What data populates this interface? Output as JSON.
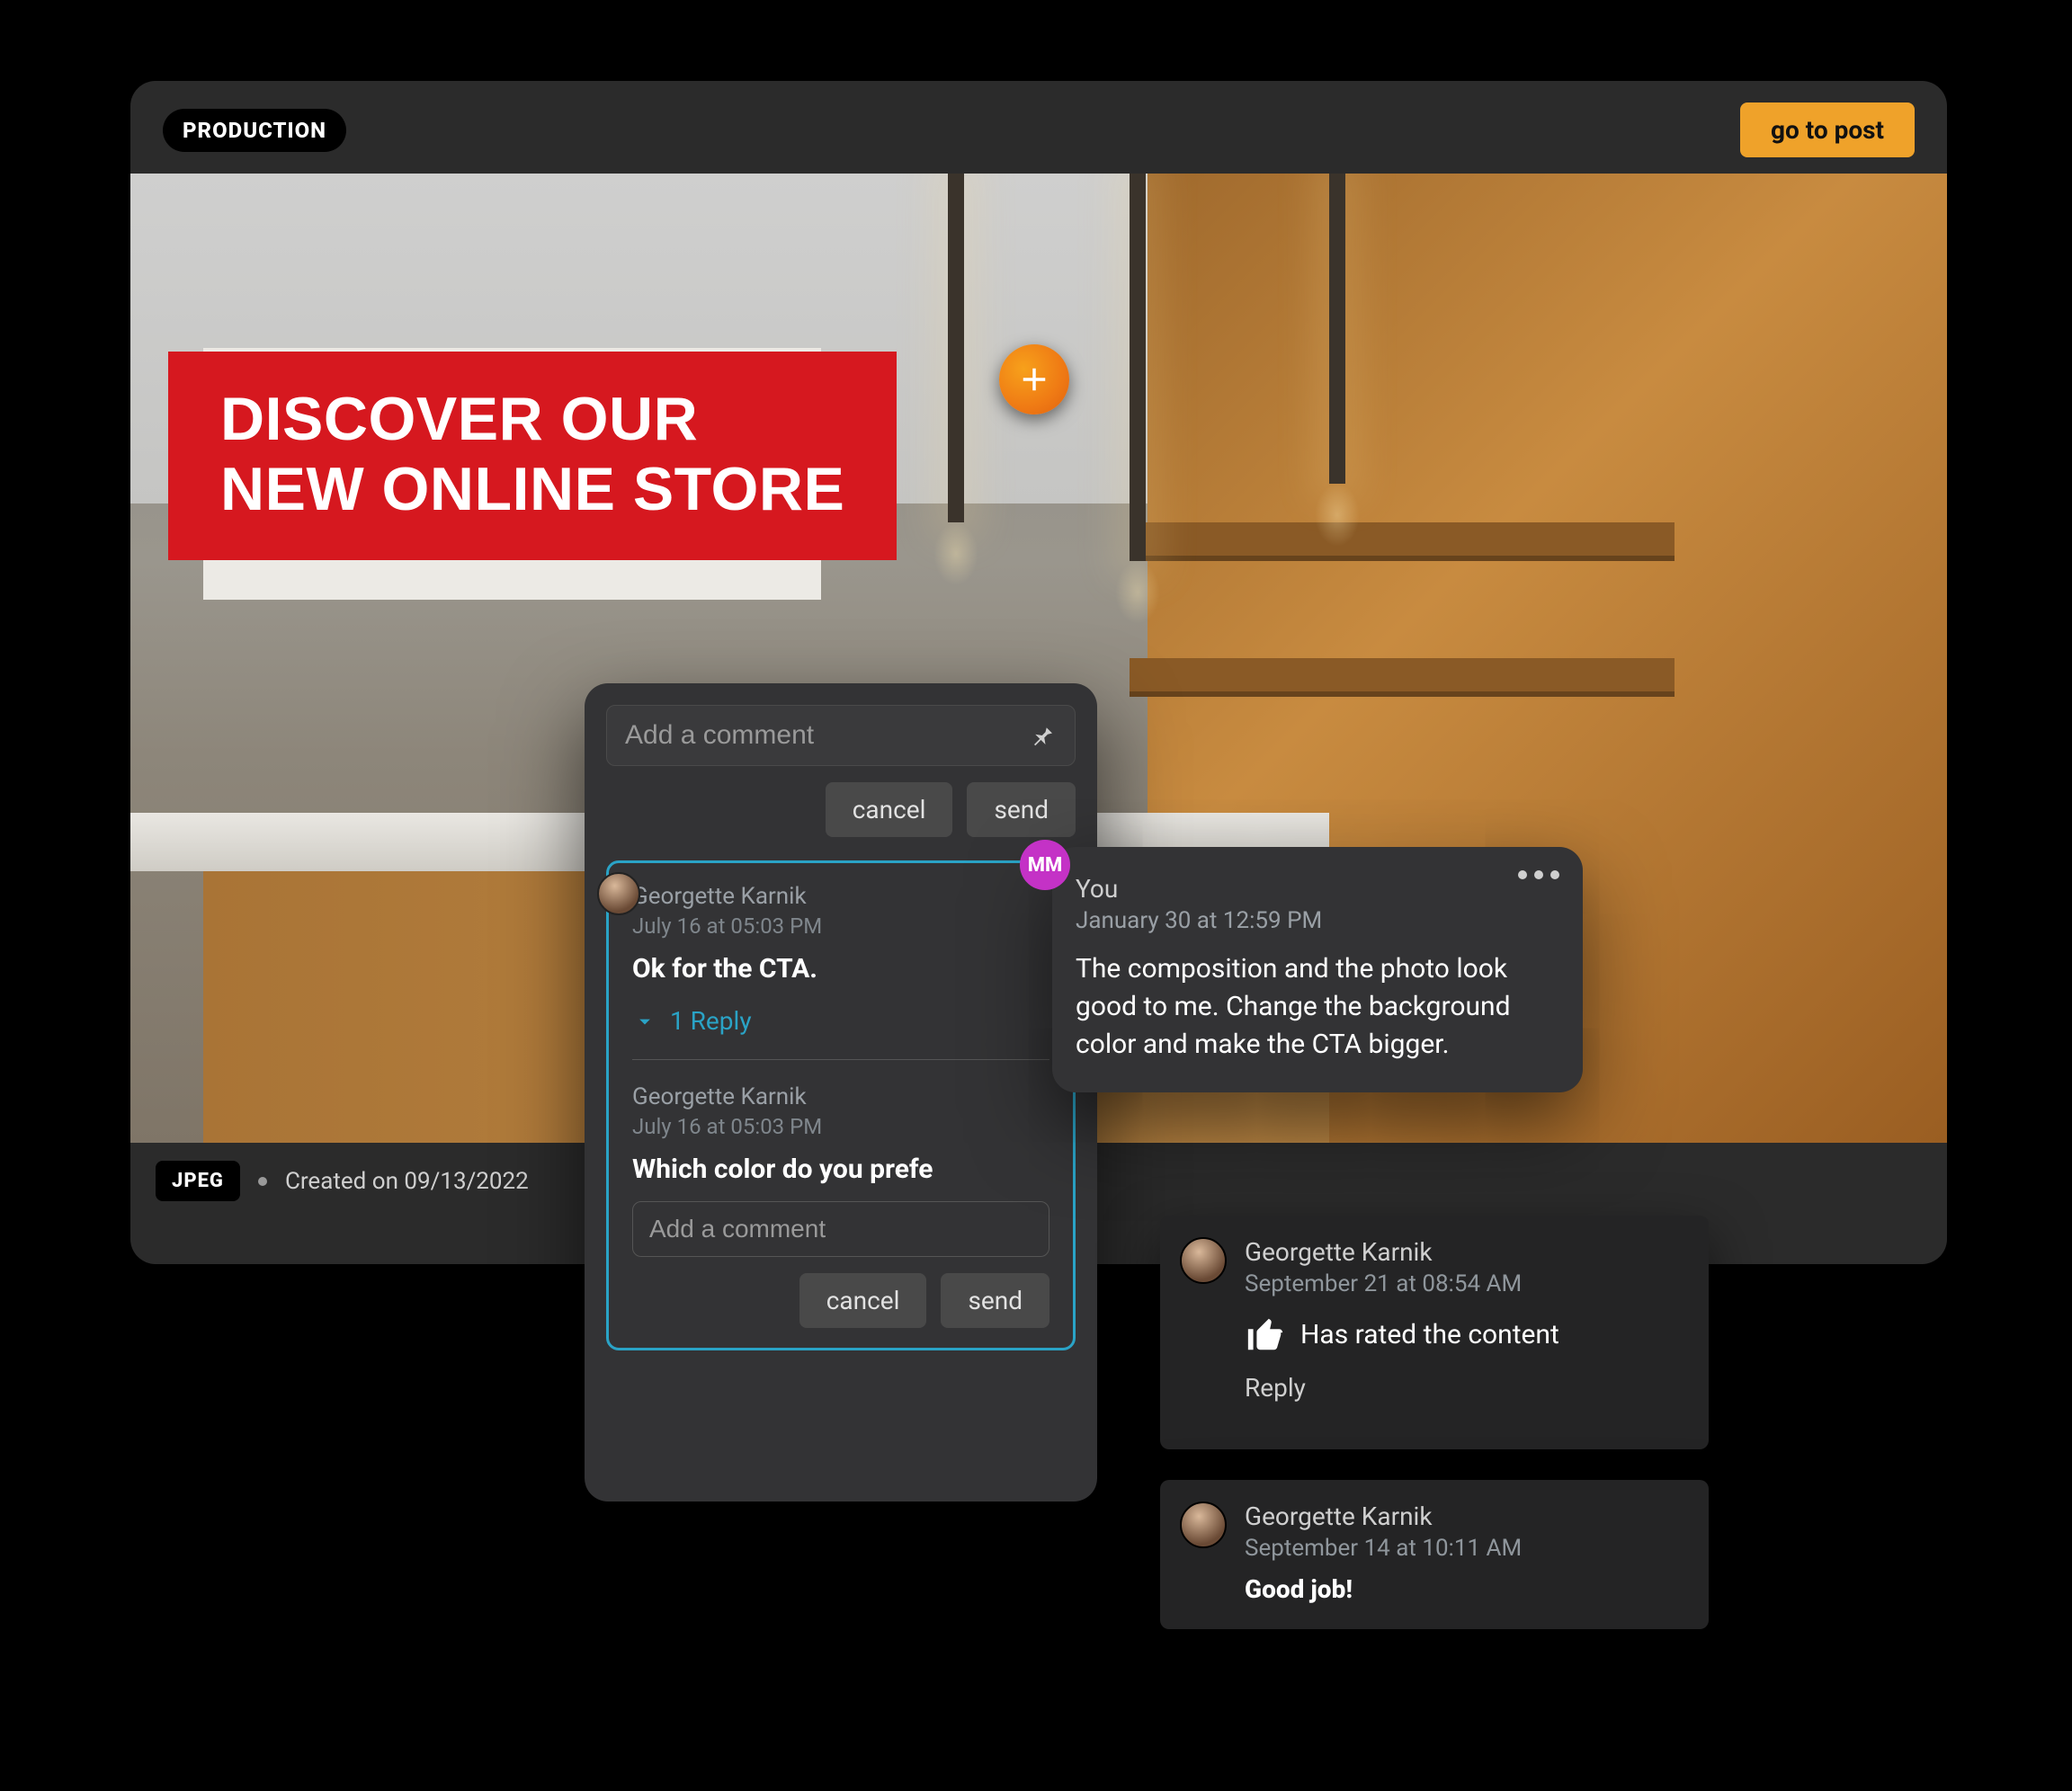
{
  "header": {
    "badge": "PRODUCTION",
    "go_to_post": "go to post"
  },
  "banner": {
    "line1": "DISCOVER OUR",
    "line2": "NEW ONLINE STORE"
  },
  "footer": {
    "format": "JPEG",
    "created": "Created on 09/13/2022"
  },
  "compose": {
    "placeholder": "Add a comment",
    "cancel": "cancel",
    "send": "send"
  },
  "thread": {
    "c1": {
      "author": "Georgette Karnik",
      "date": "July 16 at 05:03 PM",
      "text": "Ok for the CTA.",
      "reply_count": "1 Reply"
    },
    "c2": {
      "author": "Georgette Karnik",
      "date": "July 16 at 05:03 PM",
      "text": "Which color do you prefe"
    },
    "reply_placeholder": "Add a comment",
    "cancel": "cancel",
    "send": "send"
  },
  "right": {
    "avatar_initials": "MM",
    "author": "You",
    "date": "January 30 at 12:59 PM",
    "body": "The composition and the photo look good to me. Change the background color and make the CTA bigger."
  },
  "notif1": {
    "author": "Georgette Karnik",
    "date": "September 21 at 08:54 AM",
    "text": "Has rated the content",
    "reply": "Reply"
  },
  "notif2": {
    "author": "Georgette Karnik",
    "date": "September 14 at 10:11 AM",
    "body": "Good job!"
  }
}
